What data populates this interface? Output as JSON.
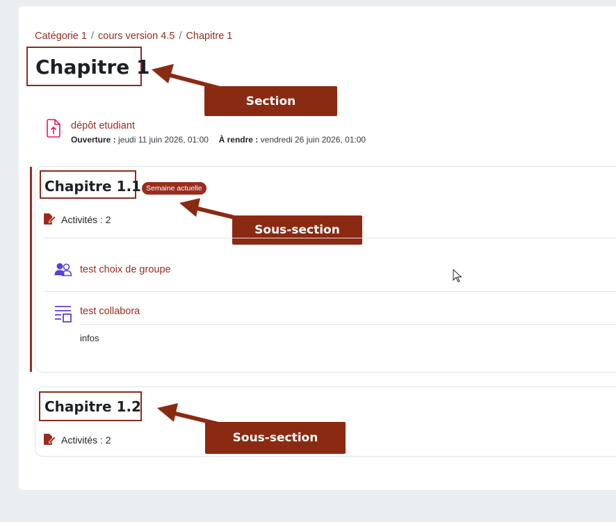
{
  "breadcrumb": {
    "items": [
      "Catégorie 1",
      "cours version 4.5",
      "Chapitre 1"
    ],
    "separator": "/"
  },
  "section": {
    "title": "Chapitre 1",
    "callout": "Section"
  },
  "assignment": {
    "name": "dépôt etudiant",
    "open_label": "Ouverture :",
    "open_value": "jeudi 11 juin 2026, 01:00",
    "due_label": "À rendre :",
    "due_value": "vendredi 26 juin 2026, 01:00"
  },
  "subsection1": {
    "title": "Chapitre 1.1",
    "badge": "Semaine actuelle",
    "activities": "Activités : 2",
    "callout": "Sous-section",
    "modules": [
      {
        "name": "test choix de groupe",
        "icon": "group-choice-icon"
      },
      {
        "name": "test collabora",
        "icon": "collabora-icon",
        "description": "infos"
      }
    ]
  },
  "subsection2": {
    "title": "Chapitre 1.2",
    "activities": "Activités : 2",
    "callout": "Sous-section"
  },
  "colors": {
    "accent": "#9a2c1f",
    "callout_bg": "#8b2a13",
    "icon_purple": "#5b40d6",
    "icon_pink": "#e0185e"
  }
}
